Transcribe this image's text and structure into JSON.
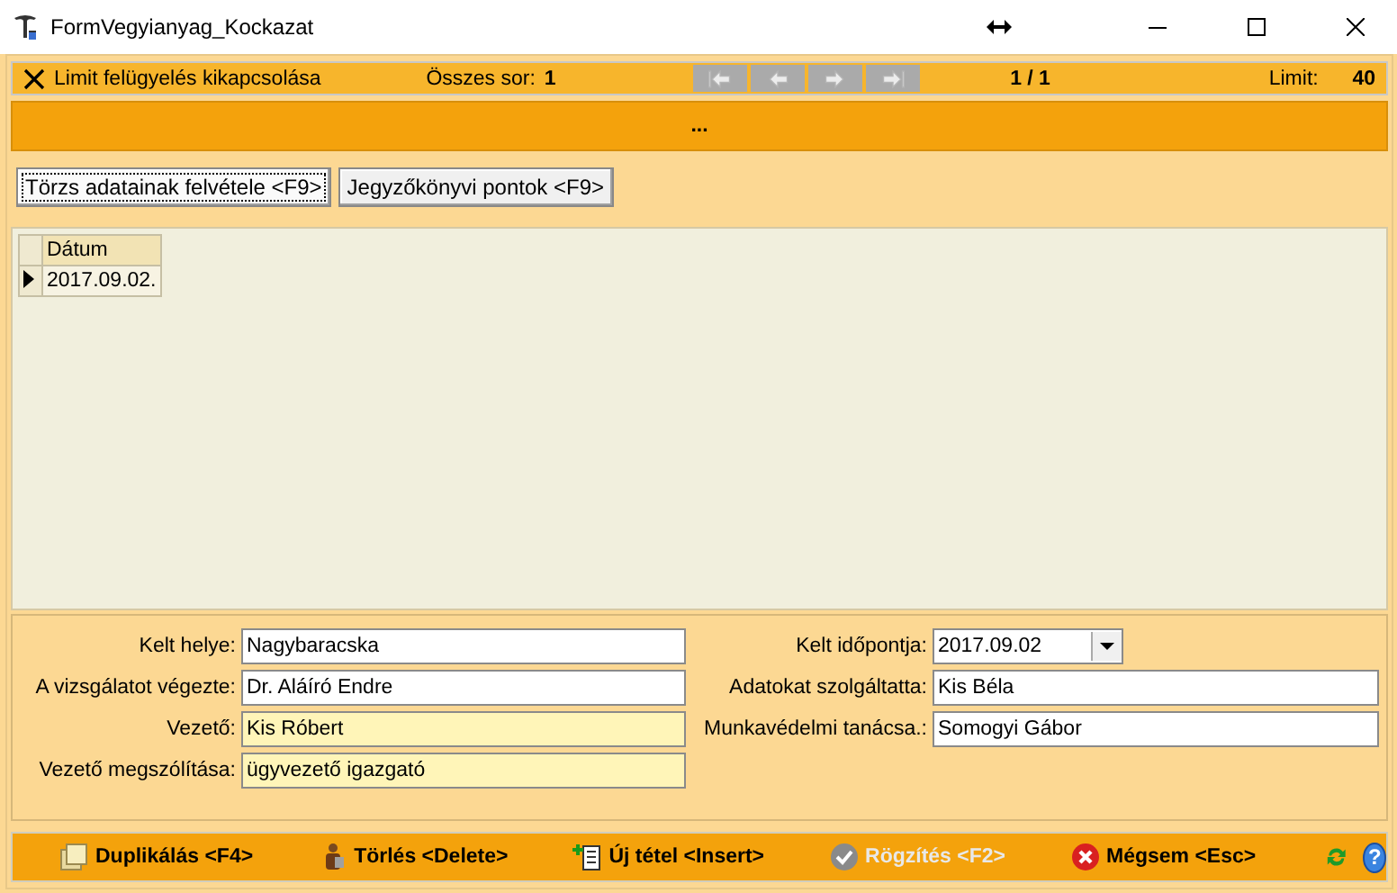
{
  "window": {
    "title": "FormVegyianyag_Kockazat"
  },
  "toolbar": {
    "limit_toggle": "Limit felügyelés kikapcsolása",
    "total_label": "Összes sor:",
    "total_value": "1",
    "nav_buttons": [
      {
        "kind": "first",
        "disabled": true
      },
      {
        "kind": "prev",
        "disabled": true
      },
      {
        "kind": "next",
        "disabled": true
      },
      {
        "kind": "last",
        "disabled": true
      }
    ],
    "position": "1  / 1",
    "limit_label": "Limit:",
    "limit_value": "40"
  },
  "banner": {
    "text": "..."
  },
  "tabs": [
    {
      "label": "Törzs adatainak felvétele <F9>",
      "selected": true
    },
    {
      "label": "Jegyzőkönyvi pontok <F9>",
      "selected": false
    }
  ],
  "table": {
    "columns": [
      "Dátum"
    ],
    "rows": [
      {
        "cells": [
          "2017.09.02."
        ],
        "selected": true
      }
    ]
  },
  "form": {
    "left": [
      {
        "label": "Kelt helye:",
        "value": "Nagybaracska",
        "kind": "text",
        "highlighted": false
      },
      {
        "label": "A vizsgálatot végezte:",
        "value": "Dr. Aláíró Endre",
        "kind": "text",
        "highlighted": false
      },
      {
        "label": "Vezető:",
        "value": "Kis Róbert",
        "kind": "text",
        "highlighted": true
      },
      {
        "label": "Vezető megszólítása:",
        "value": "ügyvezető igazgató",
        "kind": "text",
        "highlighted": true
      }
    ],
    "right": [
      {
        "label": "Kelt időpontja:",
        "value": "2017.09.02",
        "kind": "date"
      },
      {
        "label": "Adatokat szolgáltatta:",
        "value": "Kis Béla",
        "kind": "text",
        "highlighted": false
      },
      {
        "label": "Munkavédelmi tanácsa.:",
        "value": "Somogyi Gábor",
        "kind": "text",
        "highlighted": false
      }
    ]
  },
  "actions": [
    {
      "kind": "duplicate",
      "label": "Duplikálás <F4>",
      "disabled": false
    },
    {
      "kind": "delete",
      "label": "Törlés <Delete>",
      "disabled": false
    },
    {
      "kind": "new",
      "label": "Új tétel <Insert>",
      "disabled": false
    },
    {
      "kind": "save",
      "label": "Rögzítés <F2>",
      "disabled": true
    },
    {
      "kind": "cancel",
      "label": "Mégsem <Esc>",
      "disabled": false
    }
  ],
  "help": {
    "glyph": "?"
  }
}
